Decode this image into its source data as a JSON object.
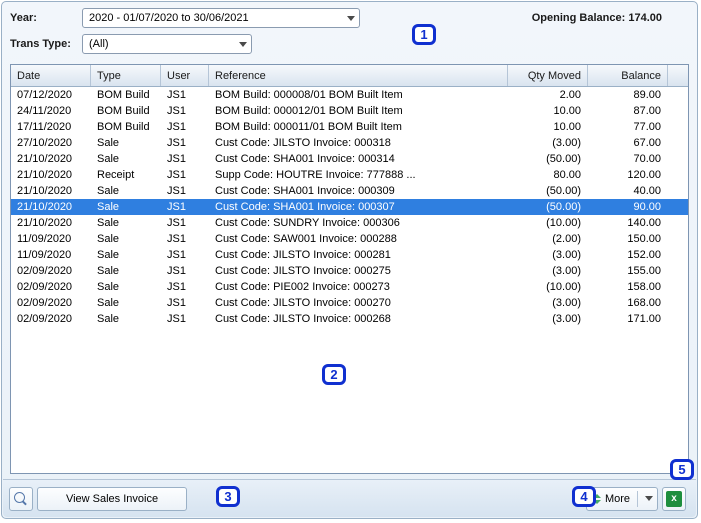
{
  "filters": {
    "year_label": "Year:",
    "year_value": "2020 - 01/07/2020 to 30/06/2021",
    "trans_type_label": "Trans Type:",
    "trans_type_value": "(All)"
  },
  "opening_balance": {
    "label": "Opening Balance:",
    "value": "174.00"
  },
  "columns": {
    "date": "Date",
    "type": "Type",
    "user": "User",
    "reference": "Reference",
    "qty": "Qty Moved",
    "balance": "Balance"
  },
  "rows": [
    {
      "date": "07/12/2020",
      "type": "BOM Build",
      "user": "JS1",
      "ref": "BOM Build: 000008/01 BOM Built Item",
      "qty": "2.00",
      "bal": "89.00",
      "sel": false
    },
    {
      "date": "24/11/2020",
      "type": "BOM Build",
      "user": "JS1",
      "ref": "BOM Build: 000012/01 BOM Built Item",
      "qty": "10.00",
      "bal": "87.00",
      "sel": false
    },
    {
      "date": "17/11/2020",
      "type": "BOM Build",
      "user": "JS1",
      "ref": "BOM Build: 000011/01 BOM Built Item",
      "qty": "10.00",
      "bal": "77.00",
      "sel": false
    },
    {
      "date": "27/10/2020",
      "type": "Sale",
      "user": "JS1",
      "ref": "Cust Code: JILSTO   Invoice: 000318",
      "qty": "(3.00)",
      "bal": "67.00",
      "sel": false
    },
    {
      "date": "21/10/2020",
      "type": "Sale",
      "user": "JS1",
      "ref": "Cust Code: SHA001   Invoice: 000314",
      "qty": "(50.00)",
      "bal": "70.00",
      "sel": false
    },
    {
      "date": "21/10/2020",
      "type": "Receipt",
      "user": "JS1",
      "ref": "Supp Code: HOUTRE   Invoice: 777888  ...",
      "qty": "80.00",
      "bal": "120.00",
      "sel": false
    },
    {
      "date": "21/10/2020",
      "type": "Sale",
      "user": "JS1",
      "ref": "Cust Code: SHA001   Invoice: 000309",
      "qty": "(50.00)",
      "bal": "40.00",
      "sel": false
    },
    {
      "date": "21/10/2020",
      "type": "Sale",
      "user": "JS1",
      "ref": "Cust Code: SHA001   Invoice: 000307",
      "qty": "(50.00)",
      "bal": "90.00",
      "sel": true
    },
    {
      "date": "21/10/2020",
      "type": "Sale",
      "user": "JS1",
      "ref": "Cust Code: SUNDRY   Invoice: 000306",
      "qty": "(10.00)",
      "bal": "140.00",
      "sel": false
    },
    {
      "date": "11/09/2020",
      "type": "Sale",
      "user": "JS1",
      "ref": "Cust Code: SAW001   Invoice: 000288",
      "qty": "(2.00)",
      "bal": "150.00",
      "sel": false
    },
    {
      "date": "11/09/2020",
      "type": "Sale",
      "user": "JS1",
      "ref": "Cust Code: JILSTO   Invoice: 000281",
      "qty": "(3.00)",
      "bal": "152.00",
      "sel": false
    },
    {
      "date": "02/09/2020",
      "type": "Sale",
      "user": "JS1",
      "ref": "Cust Code: JILSTO   Invoice: 000275",
      "qty": "(3.00)",
      "bal": "155.00",
      "sel": false
    },
    {
      "date": "02/09/2020",
      "type": "Sale",
      "user": "JS1",
      "ref": "Cust Code: PIE002   Invoice: 000273",
      "qty": "(10.00)",
      "bal": "158.00",
      "sel": false
    },
    {
      "date": "02/09/2020",
      "type": "Sale",
      "user": "JS1",
      "ref": "Cust Code: JILSTO   Invoice: 000270",
      "qty": "(3.00)",
      "bal": "168.00",
      "sel": false
    },
    {
      "date": "02/09/2020",
      "type": "Sale",
      "user": "JS1",
      "ref": "Cust Code: JILSTO   Invoice: 000268",
      "qty": "(3.00)",
      "bal": "171.00",
      "sel": false
    }
  ],
  "footer": {
    "view_label": "View Sales Invoice",
    "more_label": "More"
  },
  "callouts": {
    "c1": "1",
    "c2": "2",
    "c3": "3",
    "c4": "4",
    "c5": "5"
  }
}
